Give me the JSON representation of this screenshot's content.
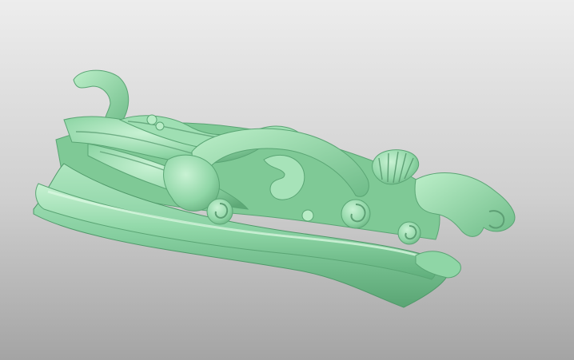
{
  "scene": {
    "model_color": "#8fd9a7",
    "model_highlight": "#c7f1d2",
    "model_shadow": "#5aa574",
    "background_top": "#ededed",
    "background_bottom": "#a4a4a4"
  }
}
